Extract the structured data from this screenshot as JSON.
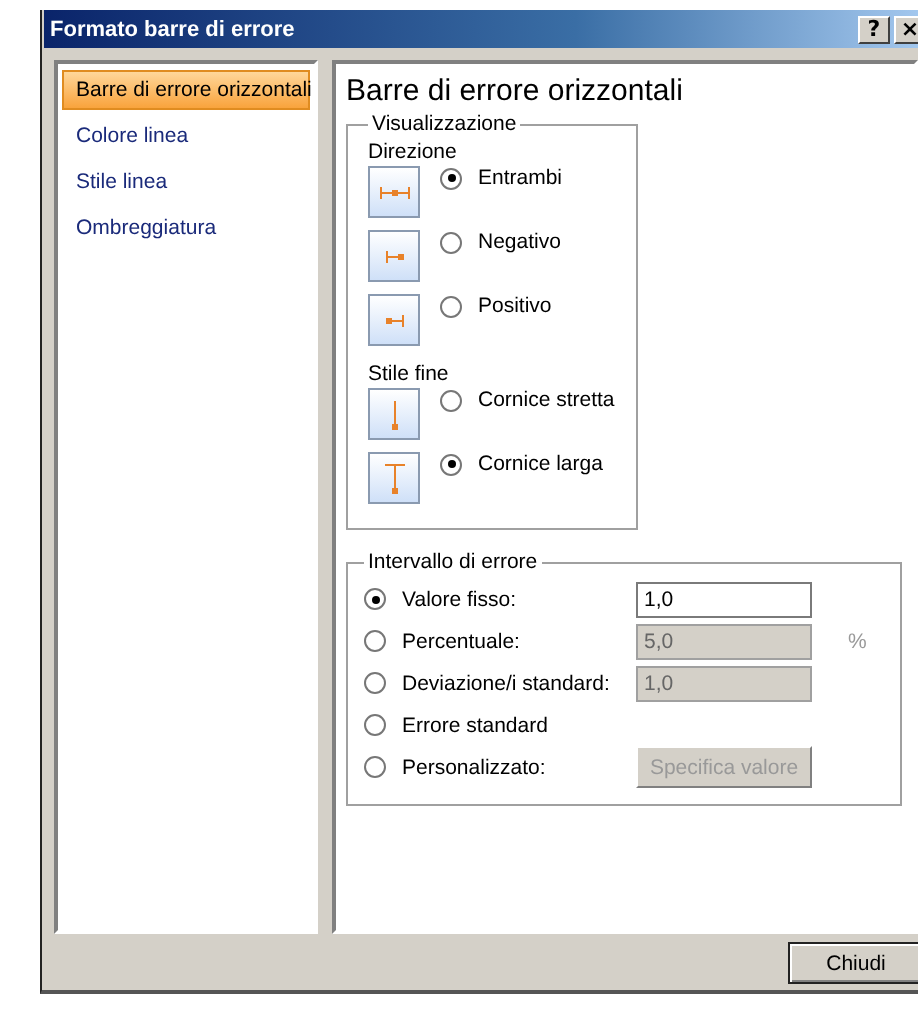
{
  "window": {
    "title": "Formato barre di errore",
    "help": "?",
    "close": "×"
  },
  "sidebar": {
    "items": [
      {
        "label": "Barre di errore orizzontali",
        "selected": true
      },
      {
        "label": "Colore linea",
        "selected": false
      },
      {
        "label": "Stile linea",
        "selected": false
      },
      {
        "label": "Ombreggiatura",
        "selected": false
      }
    ]
  },
  "panel": {
    "title": "Barre di errore orizzontali",
    "display": {
      "legend": "Visualizzazione",
      "direction_label": "Direzione",
      "directions": [
        {
          "label": "Entrambi",
          "kind": "both",
          "selected": true
        },
        {
          "label": "Negativo",
          "kind": "minus",
          "selected": false
        },
        {
          "label": "Positivo",
          "kind": "plus",
          "selected": false
        }
      ],
      "end_style_label": "Stile fine",
      "end_styles": [
        {
          "label": "Cornice stretta",
          "kind": "nocap",
          "selected": false
        },
        {
          "label": "Cornice larga",
          "kind": "cap",
          "selected": true
        }
      ]
    },
    "error_amount": {
      "legend": "Intervallo di errore",
      "options": [
        {
          "label": "Valore fisso:",
          "kind": "field",
          "value": "1,0",
          "disabled": false,
          "selected": true
        },
        {
          "label": "Percentuale:",
          "kind": "field",
          "value": "5,0",
          "unit": "%",
          "disabled": true,
          "selected": false
        },
        {
          "label": "Deviazione/i standard:",
          "kind": "field",
          "value": "1,0",
          "disabled": true,
          "selected": false
        },
        {
          "label": "Errore standard",
          "kind": "plain",
          "selected": false
        },
        {
          "label": "Personalizzato:",
          "kind": "button",
          "button": "Specifica valore",
          "disabled": true,
          "selected": false
        }
      ]
    }
  },
  "buttons": [
    "Chiudi"
  ]
}
